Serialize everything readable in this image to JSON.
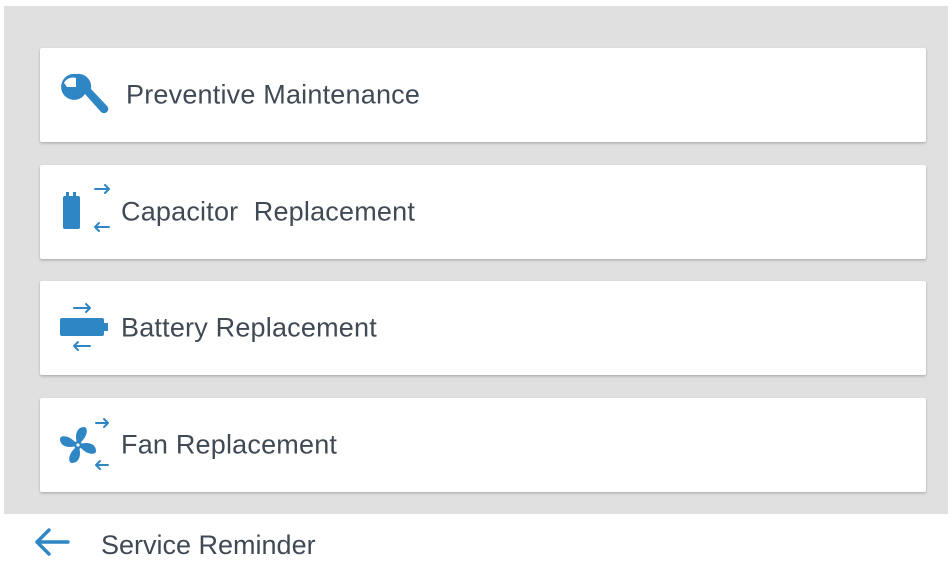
{
  "colors": {
    "accent": "#2f86c4",
    "background": "#e0e0e0",
    "card": "#ffffff",
    "text": "#404a55"
  },
  "menu": {
    "items": [
      {
        "label": "Preventive Maintenance",
        "icon": "wrench-icon"
      },
      {
        "label": "Capacitor  Replacement",
        "icon": "capacitor-replace-icon"
      },
      {
        "label": "Battery Replacement",
        "icon": "battery-replace-icon"
      },
      {
        "label": "Fan Replacement",
        "icon": "fan-replace-icon"
      }
    ]
  },
  "footer": {
    "back_icon": "arrow-left-icon",
    "title": "Service Reminder"
  }
}
